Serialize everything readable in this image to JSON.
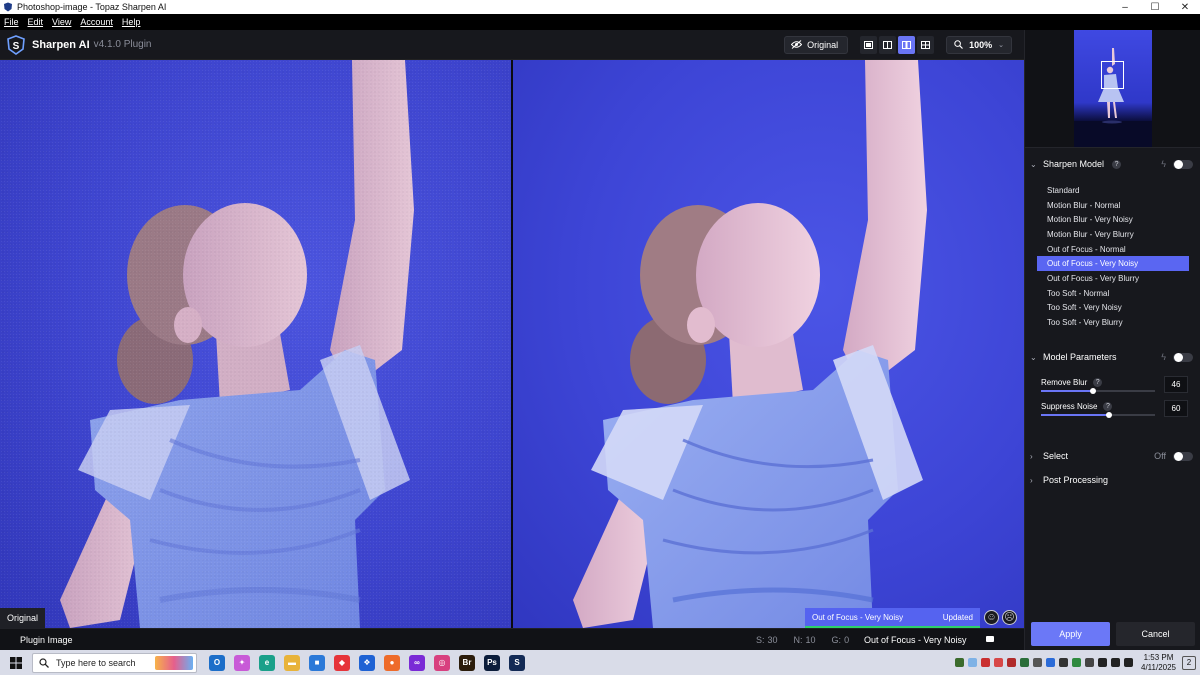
{
  "window": {
    "title": "Photoshop-image - Topaz Sharpen AI",
    "controls": [
      "–",
      "☐",
      "✕"
    ]
  },
  "menu": [
    "File",
    "Edit",
    "View",
    "Account",
    "Help"
  ],
  "header": {
    "brand": "Sharpen AI",
    "version": "v4.1.0 Plugin",
    "original_label": "Original",
    "zoom": "100%"
  },
  "preview": {
    "left_label": "Original",
    "status_model": "Out of Focus - Very Noisy",
    "status_state": "Updated",
    "backdrop_color": "#3f48db"
  },
  "statusbar": {
    "source": "Plugin Image",
    "s_label": "S:",
    "s_value": "30",
    "n_label": "N:",
    "n_value": "10",
    "g_label": "G:",
    "g_value": "0",
    "model": "Out of Focus - Very Noisy"
  },
  "panel": {
    "sharpen_model": {
      "title": "Sharpen Model",
      "items": [
        "Standard",
        "Motion Blur - Normal",
        "Motion Blur - Very Noisy",
        "Motion Blur - Very Blurry",
        "Out of Focus - Normal",
        "Out of Focus - Very Noisy",
        "Out of Focus - Very Blurry",
        "Too Soft - Normal",
        "Too Soft - Very Noisy",
        "Too Soft - Very Blurry"
      ],
      "selected": "Out of Focus - Very Noisy"
    },
    "model_parameters": {
      "title": "Model Parameters",
      "remove_blur": {
        "label": "Remove Blur",
        "value": "46",
        "fraction": 0.46
      },
      "suppress_noise": {
        "label": "Suppress Noise",
        "value": "60",
        "fraction": 0.6
      }
    },
    "select": {
      "title": "Select",
      "state": "Off"
    },
    "post_processing": {
      "title": "Post Processing"
    },
    "apply_label": "Apply",
    "cancel_label": "Cancel",
    "accent": "#6b78f7"
  },
  "taskbar": {
    "search_placeholder": "Type here to search",
    "apps": [
      {
        "name": "outlook",
        "glyph": "O",
        "color": "#1c6ec9"
      },
      {
        "name": "copilot",
        "glyph": "✦",
        "color": "#c85ad7"
      },
      {
        "name": "edge",
        "glyph": "e",
        "color": "#1aa08a"
      },
      {
        "name": "file-explorer",
        "glyph": "▬",
        "color": "#e8b33a"
      },
      {
        "name": "store",
        "glyph": "■",
        "color": "#2b79d8"
      },
      {
        "name": "app-red",
        "glyph": "◆",
        "color": "#e6343a"
      },
      {
        "name": "dropbox",
        "glyph": "❖",
        "color": "#1e62d4"
      },
      {
        "name": "firefox",
        "glyph": "●",
        "color": "#ee6b2a"
      },
      {
        "name": "app-infinity",
        "glyph": "∞",
        "color": "#7a2ad6"
      },
      {
        "name": "instagram",
        "glyph": "◎",
        "color": "#d8407f"
      },
      {
        "name": "bridge",
        "glyph": "Br",
        "color": "#2b1c0b"
      },
      {
        "name": "photoshop",
        "glyph": "Ps",
        "color": "#0b1c3a"
      },
      {
        "name": "sharpen-ai",
        "glyph": "S",
        "color": "#132a55"
      }
    ],
    "time": "1:53 PM",
    "date": "4/11/2025",
    "notifications": "2"
  }
}
